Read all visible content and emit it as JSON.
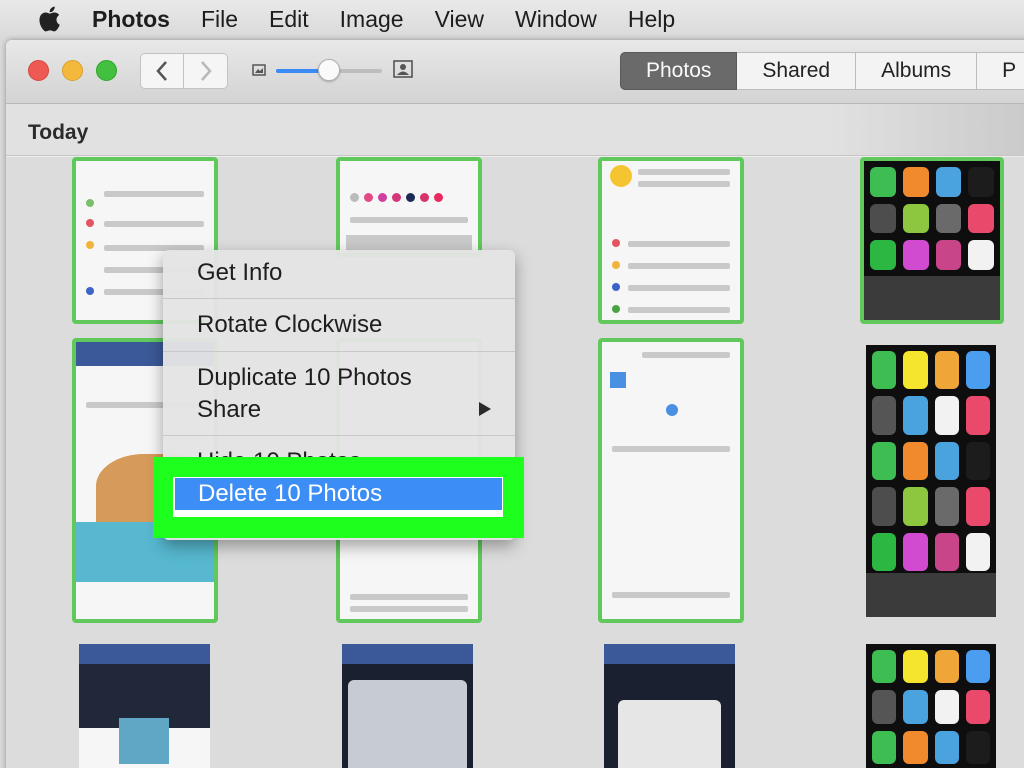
{
  "menubar": {
    "apple_icon": "apple-logo-icon",
    "app_name": "Photos",
    "items": [
      "File",
      "Edit",
      "Image",
      "View",
      "Window",
      "Help"
    ]
  },
  "toolbar": {
    "back_icon": "chevron-left-icon",
    "forward_icon": "chevron-right-icon",
    "zoom_level": 0.5,
    "tabs": [
      "Photos",
      "Shared",
      "Albums",
      "P"
    ],
    "active_tab": "Photos"
  },
  "section": {
    "title": "Today"
  },
  "context_menu": {
    "items": {
      "get_info": "Get Info",
      "rotate": "Rotate Clockwise",
      "duplicate": "Duplicate 10 Photos",
      "share": "Share",
      "hide": "Hide 10 Photos",
      "delete": "Delete 10 Photos"
    },
    "highlighted": "Delete 10 Photos",
    "share_submenu_icon": "triangle-right-icon"
  },
  "colors": {
    "selection_border": "#61c95c",
    "highlight_annotation": "#1dff1d",
    "menu_selection": "#3c8ef6",
    "active_tab": "#6a6a6a"
  }
}
